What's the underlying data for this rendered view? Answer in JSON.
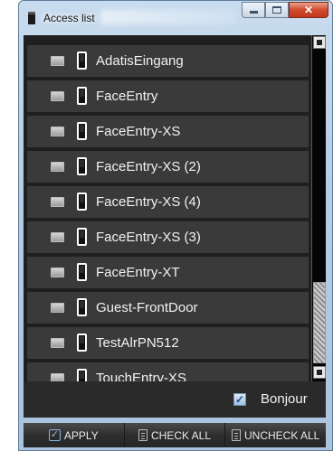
{
  "window": {
    "title": "Access list"
  },
  "list": {
    "items": [
      {
        "label": "AdatisEingang",
        "checked": false
      },
      {
        "label": "FaceEntry",
        "checked": false
      },
      {
        "label": "FaceEntry-XS",
        "checked": false
      },
      {
        "label": "FaceEntry-XS (2)",
        "checked": false
      },
      {
        "label": "FaceEntry-XS (4)",
        "checked": false
      },
      {
        "label": "FaceEntry-XS (3)",
        "checked": false
      },
      {
        "label": "FaceEntry-XT",
        "checked": false
      },
      {
        "label": "Guest-FrontDoor",
        "checked": false
      },
      {
        "label": "TestAlrPN512",
        "checked": false
      },
      {
        "label": "TouchEntry-XS",
        "checked": false
      }
    ],
    "item_icon": "device-icon"
  },
  "bonjour": {
    "label": "Bonjour",
    "checked": true
  },
  "buttons": {
    "apply": "APPLY",
    "check_all": "CHECK ALL",
    "uncheck_all": "UNCHECK ALL"
  },
  "colors": {
    "list_background": "#1f1f1f",
    "row_background": "#3a3a3a",
    "text": "#f2f2f2",
    "close_button": "#d04a2c"
  }
}
